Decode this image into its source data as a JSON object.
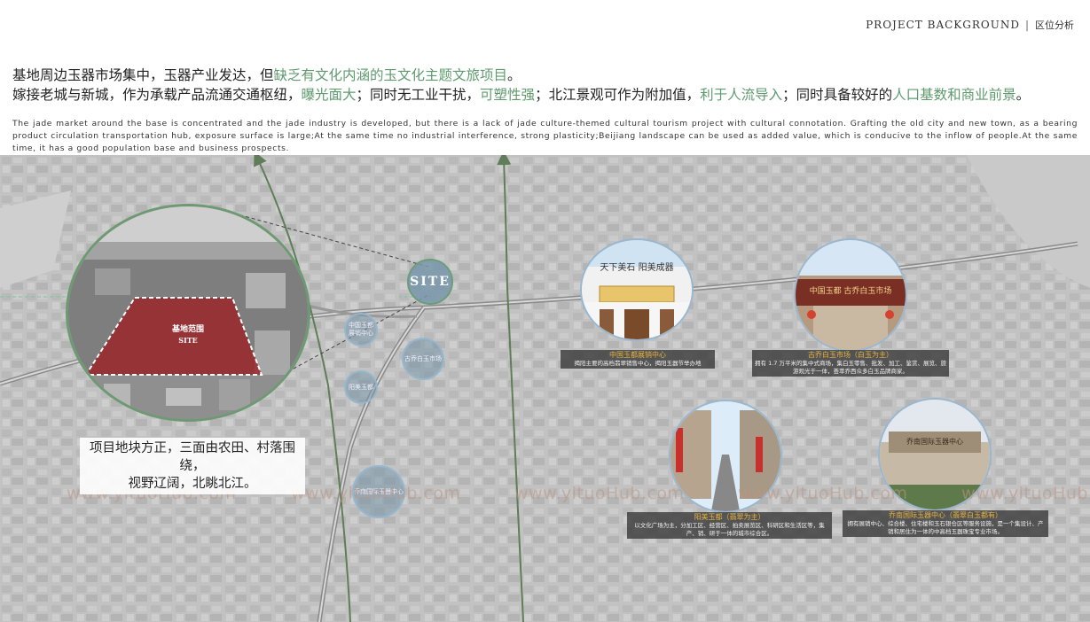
{
  "header": {
    "en": "PROJECT BACKGROUND",
    "sep": "|",
    "cn": "区位分析"
  },
  "intro_cn": {
    "line1_a": "基地周边玉器市场集中，玉器产业发达，但",
    "line1_hl": "缺乏有文化内涵的玉文化主题文旅项目",
    "line1_b": "。",
    "line2_a": "嫁接老城与新城，作为承载产品流通交通枢纽，",
    "line2_hl1": "曝光面大",
    "line2_b": "；同时无工业干扰，",
    "line2_hl2": "可塑性强",
    "line2_c": "；北江景观可作为附加值，",
    "line2_hl3": "利于人流导入",
    "line2_d": "；同时具备较好的",
    "line2_hl4": "人口基数和商业前景",
    "line2_e": "。"
  },
  "intro_en": "The jade market around the base is concentrated and the jade industry is developed, but there is a lack of jade culture-themed cultural tourism project with cultural connotation. Grafting the old city and new town, as a bearing product circulation transportation hub, exposure surface is large;At the same time no industrial interference, strong plasticity;Beijiang landscape can be used as added value, which is conducive to the inflow of people.At the same time, it has a good population base and business prospects.",
  "site_circle": {
    "label_cn": "基地范围",
    "label_en": "SITE"
  },
  "site_badge": "SITE",
  "caption": {
    "line1": "项目地块方正，三面由农田、村落围绕，",
    "line2": "视野辽阔，北眺北江。"
  },
  "nodes": {
    "n1": "中国玉都展销中心",
    "n2": "古乔白玉市场",
    "n3": "阳美玉都",
    "n4": "乔南国际玉器中心"
  },
  "markets": {
    "m1": {
      "title": "中国玉都展销中心",
      "desc": "揭阳主要的高档翡翠销售中心，揭阳玉器节举办地",
      "sign": "天下美石 阳美成器"
    },
    "m2": {
      "title": "古乔白玉市场（白玉为主）",
      "desc": "拥有 1.7 万平米的集中式商场，集白玉零售、批发、加工、鉴赏、展览、旅游观光于一体，荟萃乔西众多白玉品牌商家。",
      "sign": "中国玉都 古乔白玉市场"
    },
    "m3": {
      "title": "阳美玉都（翡翠为主）",
      "desc": "以文化广场为主，分加工区、经营区、拍卖展览区、科研区和生活区等，集产、销、研于一体的城市综合区。"
    },
    "m4": {
      "title": "乔南国际玉器中心（翡翠白玉都有）",
      "desc": "拥有展销中心、综合楼、住宅楼和玉石银仓区等服务设施，是一个集设计、产销和居住为一体的中高档玉器珠宝专业市场。",
      "sign": "乔南国际玉器中心"
    }
  },
  "watermark": "www.yituoHub.com",
  "colors": {
    "accent_green": "#5e9a6e",
    "site_red": "#9a2226",
    "title_orange": "#e6b23d"
  }
}
